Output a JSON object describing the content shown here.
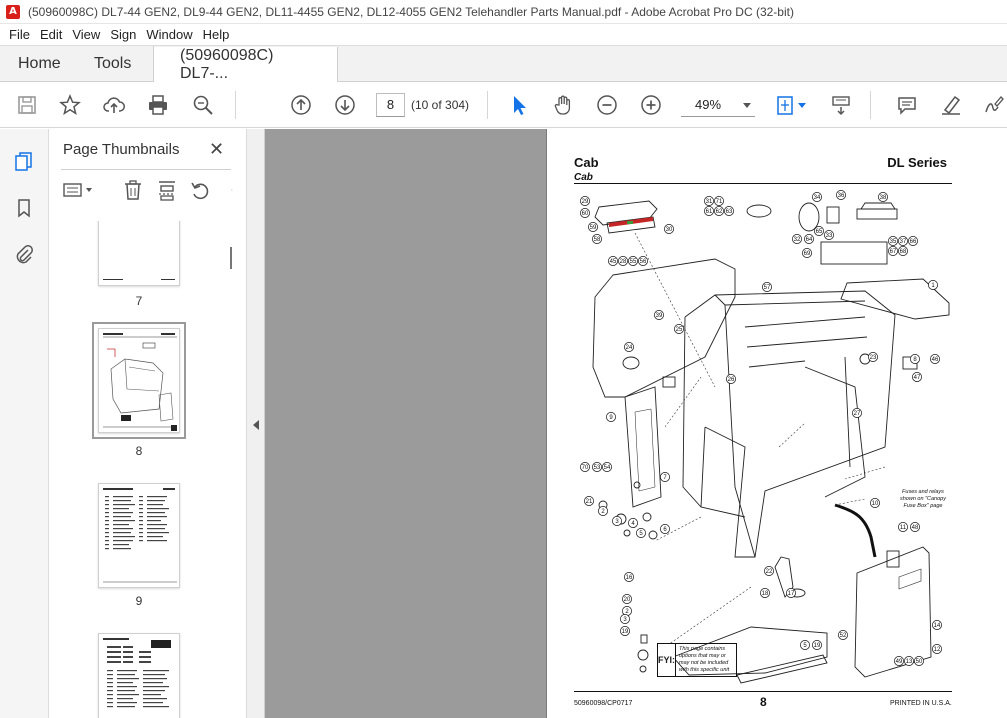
{
  "window": {
    "title": "(50960098C) DL7-44 GEN2, DL9-44 GEN2, DL11-4455 GEN2, DL12-4055 GEN2 Telehandler Parts Manual.pdf - Adobe Acrobat Pro DC (32-bit)",
    "app_icon": "acrobat-icon"
  },
  "menu": [
    "File",
    "Edit",
    "View",
    "Sign",
    "Window",
    "Help"
  ],
  "tabs": {
    "home": "Home",
    "tools": "Tools",
    "document": "(50960098C) DL7-..."
  },
  "toolbar": {
    "page_number": "8",
    "page_count": "(10 of 304)",
    "zoom": "49%"
  },
  "thumbnails_panel": {
    "title": "Page Thumbnails",
    "pages": [
      {
        "label": "7"
      },
      {
        "label": "8"
      },
      {
        "label": "9"
      }
    ]
  },
  "document": {
    "header_left": "Cab",
    "header_sub": "Cab",
    "header_right": "DL Series",
    "footer_left": "50960098/CP0717",
    "footer_page": "8",
    "footer_right": "PRINTED IN U.S.A.",
    "fyi_tag": "FYI:",
    "fyi_text": "This page contains options that may or may not be included with this specific unit",
    "fuse_note": "Fuses and relays shown on \"Canopy Fuse Box\" page",
    "callouts": [
      "29",
      "60",
      "59",
      "58",
      "30",
      "31",
      "71",
      "61",
      "62",
      "63",
      "34",
      "36",
      "38",
      "32",
      "64",
      "65",
      "33",
      "35",
      "37",
      "66",
      "67",
      "68",
      "69",
      "45",
      "28",
      "55",
      "56",
      "57",
      "1",
      "39",
      "25",
      "24",
      "26",
      "23",
      "46",
      "8",
      "47",
      "9",
      "27",
      "10",
      "11",
      "48",
      "70",
      "53",
      "54",
      "21",
      "2",
      "3",
      "4",
      "5",
      "6",
      "7",
      "22",
      "18",
      "17",
      "16",
      "20",
      "2",
      "3",
      "19",
      "5",
      "19",
      "52",
      "14",
      "12",
      "49",
      "13",
      "50",
      "51"
    ]
  }
}
